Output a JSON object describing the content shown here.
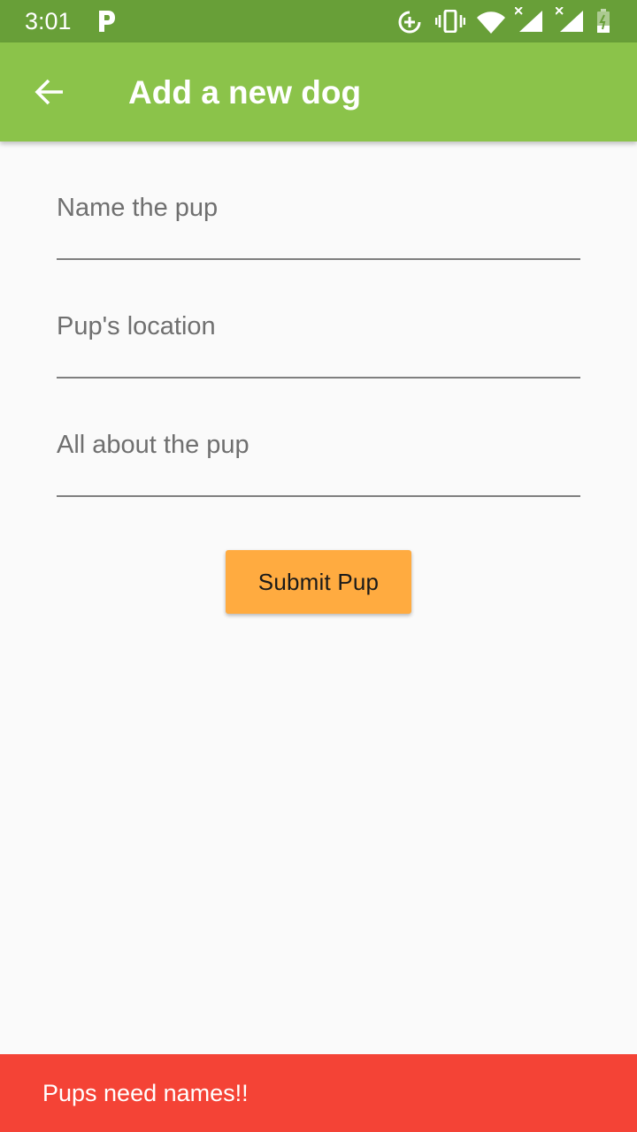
{
  "status_bar": {
    "time": "3:01",
    "color": "#689f38",
    "icons": [
      "parking-icon",
      "data-saver-icon",
      "vibrate-icon",
      "wifi-icon",
      "signal-icon",
      "signal-icon",
      "battery-icon"
    ]
  },
  "app_bar": {
    "title": "Add a new dog",
    "back_icon": "arrow-back-icon",
    "color": "#8bc34a"
  },
  "form": {
    "name_placeholder": "Name the pup",
    "name_value": "",
    "location_placeholder": "Pup's location",
    "location_value": "",
    "about_placeholder": "All about the pup",
    "about_value": "",
    "submit_label": "Submit Pup",
    "submit_color": "#ffab40"
  },
  "snackbar": {
    "message": "Pups need names!!",
    "color": "#f44336"
  }
}
